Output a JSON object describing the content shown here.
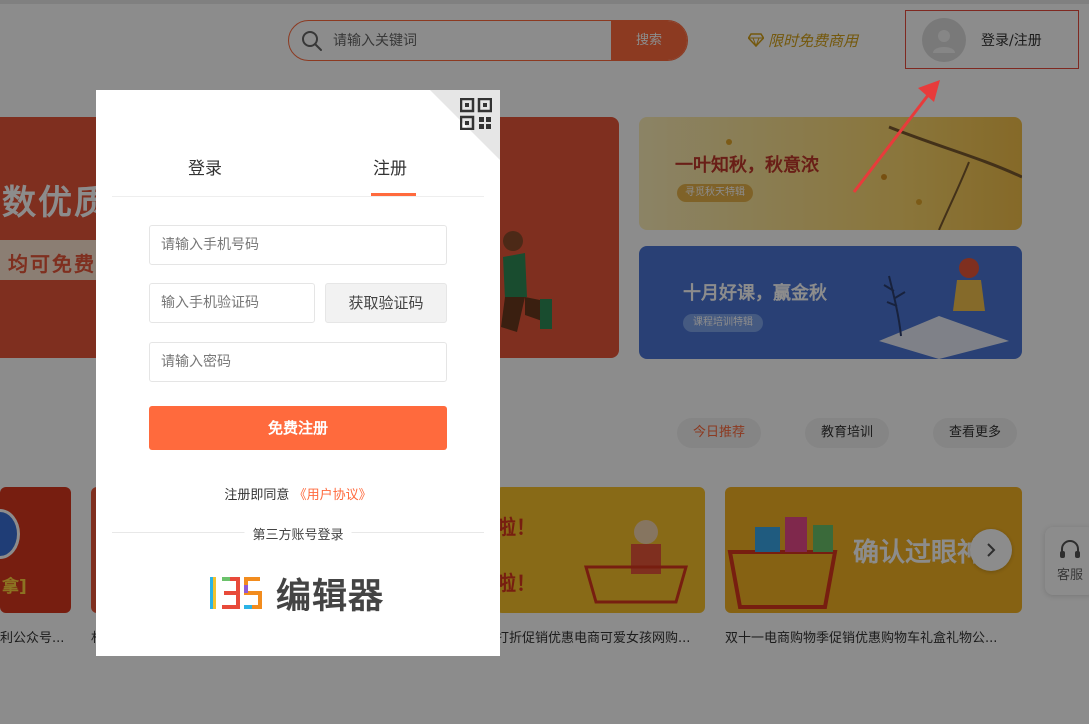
{
  "header": {
    "search": {
      "placeholder": "请输入关键词",
      "button_label": "搜索"
    },
    "vip_label": "限时免费商用",
    "login_label": "登录/注册"
  },
  "banners": {
    "main": {
      "title": "数优质",
      "subtitle": "均可免费"
    },
    "autumn": {
      "title": "一叶知秋，秋意浓",
      "tag": "寻觅秋天特辑"
    },
    "course": {
      "title": "十月好课，赢金秋",
      "tag": "课程培训特辑"
    }
  },
  "filters": [
    {
      "label": "今日推荐",
      "active": true
    },
    {
      "label": "教育培训",
      "active": false
    },
    {
      "label": "查看更多",
      "active": false
    }
  ],
  "cards": [
    {
      "caption": "利公众号...",
      "overlay_text": "拿]"
    },
    {
      "caption": "村",
      "overlay_text": ""
    },
    {
      "caption": "打折促销优惠电商可爱女孩网购...",
      "overlay_text": "啦！"
    },
    {
      "caption": "双十一电商购物季促销优惠购物车礼盒礼物公...",
      "overlay_text": "确认过眼神"
    }
  ],
  "service_label": "客服",
  "modal": {
    "tabs": {
      "login": "登录",
      "register": "注册"
    },
    "phone_placeholder": "请输入手机号码",
    "code_placeholder": "输入手机验证码",
    "get_code_label": "获取验证码",
    "password_placeholder": "请输入密码",
    "register_button": "免费注册",
    "agree_prefix": "注册即同意",
    "agreement_link": "《用户协议》",
    "third_party_label": "第三方账号登录",
    "brand_name": "编辑器",
    "brand_logo_text": "135"
  },
  "colors": {
    "accent": "#ff6a3d",
    "highlight_box": "#e74c3c",
    "arrow": "#e83b3b"
  }
}
